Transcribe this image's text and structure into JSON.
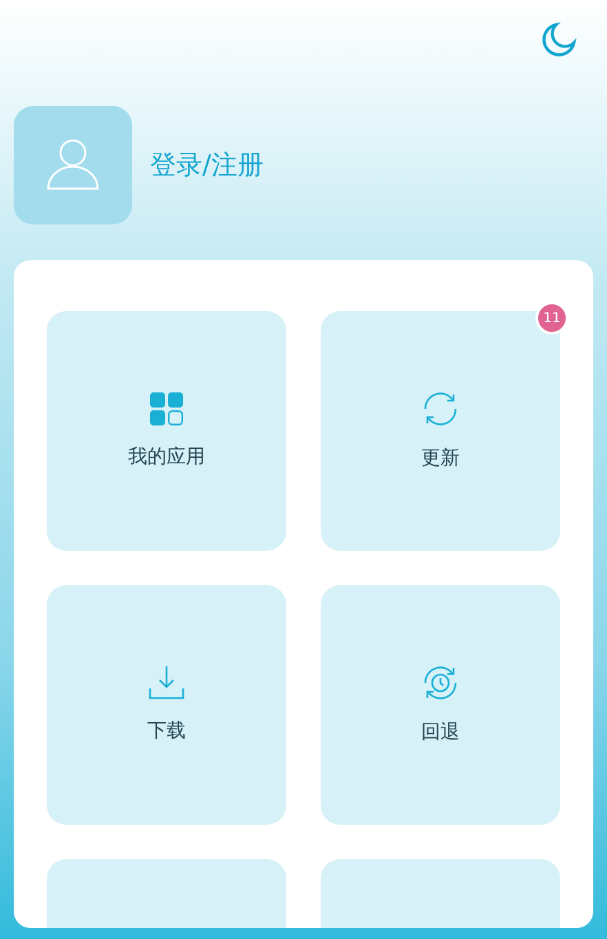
{
  "header": {
    "login_label": "登录/注册"
  },
  "tiles": [
    {
      "kind": "apps",
      "label": "我的应用"
    },
    {
      "kind": "update",
      "label": "更新",
      "badge": "11"
    },
    {
      "kind": "download",
      "label": "下载"
    },
    {
      "kind": "rollback",
      "label": "回退"
    },
    {
      "kind": "blank"
    },
    {
      "kind": "blank"
    }
  ]
}
